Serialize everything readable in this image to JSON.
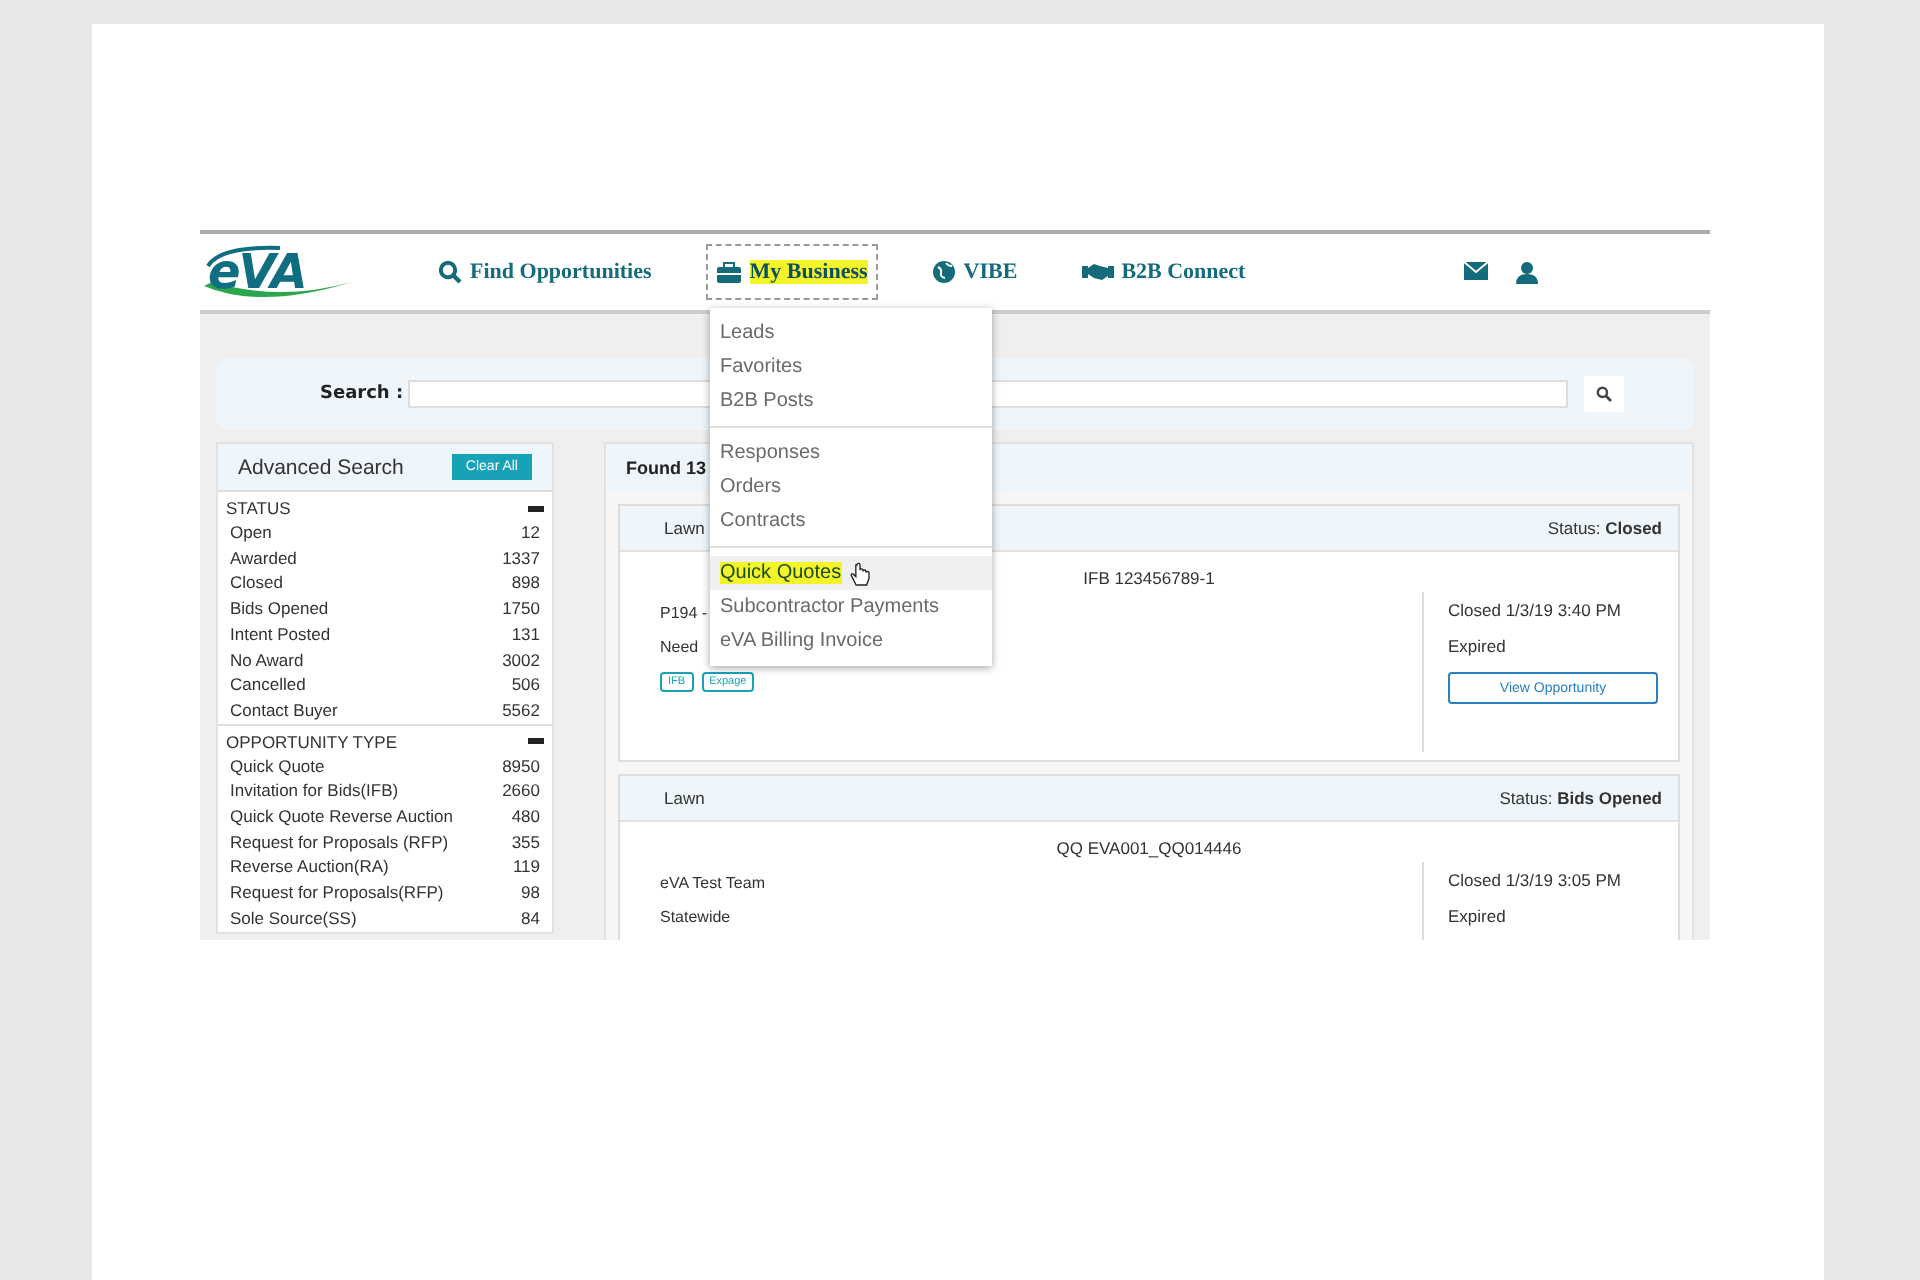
{
  "header": {
    "logo": "eVA",
    "nav": [
      {
        "label": "Find Opportunities",
        "selected": false
      },
      {
        "label": "My Business",
        "selected": true
      },
      {
        "label": "VIBE",
        "selected": false
      },
      {
        "label": "B2B Connect",
        "selected": false
      }
    ]
  },
  "dropdown": {
    "groups": [
      [
        {
          "label": "Leads",
          "selected": false
        },
        {
          "label": "Favorites",
          "selected": false
        },
        {
          "label": "B2B Posts",
          "selected": false
        }
      ],
      [
        {
          "label": "Responses",
          "selected": false
        },
        {
          "label": "Orders",
          "selected": false
        },
        {
          "label": "Contracts",
          "selected": false
        }
      ],
      [
        {
          "label": "Quick Quotes",
          "selected": true
        },
        {
          "label": "Subcontractor Payments",
          "selected": false
        },
        {
          "label": "eVA Billing Invoice",
          "selected": false
        }
      ]
    ]
  },
  "search": {
    "label": "Search :"
  },
  "advanced_search": {
    "title": "Advanced Search",
    "clear_button": "Clear All",
    "sections": [
      {
        "title": "STATUS",
        "expanded": true,
        "items": [
          {
            "label": "Open",
            "count": "12"
          },
          {
            "label": "Awarded",
            "count": "1337"
          },
          {
            "label": "Closed",
            "count": "898"
          },
          {
            "label": "Bids Opened",
            "count": "1750"
          },
          {
            "label": "Intent Posted",
            "count": "131"
          },
          {
            "label": "No Award",
            "count": "3002"
          },
          {
            "label": "Cancelled",
            "count": "506"
          },
          {
            "label": "Contact Buyer",
            "count": "5562"
          }
        ]
      },
      {
        "title": "OPPORTUNITY TYPE",
        "expanded": true,
        "items": [
          {
            "label": "Quick Quote",
            "count": "8950"
          },
          {
            "label": "Invitation for Bids(IFB)",
            "count": "2660"
          },
          {
            "label": "Quick Quote Reverse Auction",
            "count": "480"
          },
          {
            "label": "Request for Proposals (RFP)",
            "count": "355"
          },
          {
            "label": "Reverse Auction(RA)",
            "count": "119"
          },
          {
            "label": "Request for Proposals(RFP)",
            "count": "98"
          },
          {
            "label": "Sole Source(SS)",
            "count": "84"
          }
        ]
      }
    ]
  },
  "results": {
    "found": "Found 13",
    "cards": [
      {
        "title": "Lawn",
        "status": "Status: **Closed**",
        "number": "IFB 123456789-1",
        "organization": "P194 -",
        "location": "Need",
        "tags": [
          "IFB",
          "Expage"
        ],
        "closed": "Closed 1/3/19 3:40 PM",
        "state": "Expired",
        "button": "View Opportunity"
      },
      {
        "title": "Lawn",
        "status": "Status: **Bids Opened**",
        "number": "QQ EVA001_QQ014446",
        "organization": "eVA Test Team",
        "location": "Statewide",
        "closed": "Closed 1/3/19 3:05 PM",
        "state": "Expired"
      }
    ]
  }
}
